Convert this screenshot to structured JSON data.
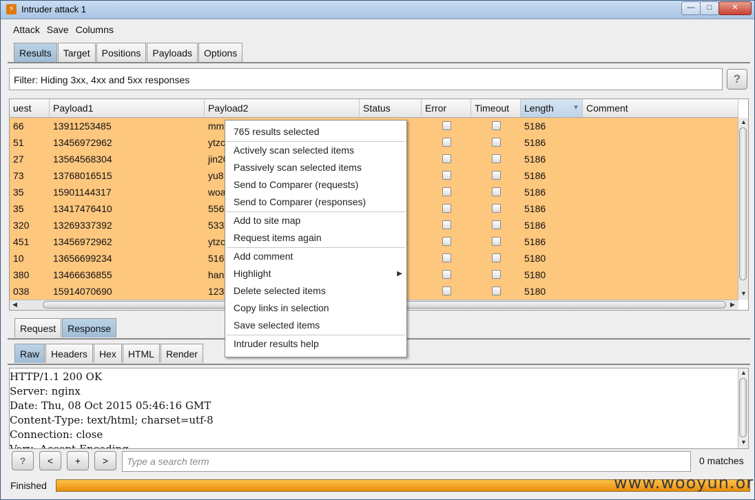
{
  "window": {
    "title": "Intruder attack 1"
  },
  "menu": [
    "Attack",
    "Save",
    "Columns"
  ],
  "tabs": [
    "Results",
    "Target",
    "Positions",
    "Payloads",
    "Options"
  ],
  "filter": {
    "text": "Filter: Hiding 3xx, 4xx and 5xx responses",
    "help": "?"
  },
  "table": {
    "columns": [
      "uest",
      "Payload1",
      "Payload2",
      "Status",
      "Error",
      "Timeout",
      "Length",
      "Comment"
    ],
    "sorted_column": "Length",
    "row_color": "#fec77e",
    "rows": [
      {
        "request": "66",
        "payload1": "13911253485",
        "payload2": "mm",
        "length": "5186"
      },
      {
        "request": "51",
        "payload1": "13456972962",
        "payload2": "ytzc",
        "length": "5186"
      },
      {
        "request": "27",
        "payload1": "13564568304",
        "payload2": "jin20",
        "length": "5186"
      },
      {
        "request": "73",
        "payload1": "13768016515",
        "payload2": "yu8",
        "length": "5186"
      },
      {
        "request": "35",
        "payload1": "15901144317",
        "payload2": "woa",
        "length": "5186"
      },
      {
        "request": "35",
        "payload1": "13417476410",
        "payload2": "556",
        "length": "5186"
      },
      {
        "request": "320",
        "payload1": "13269337392",
        "payload2": "533",
        "length": "5186"
      },
      {
        "request": "451",
        "payload1": "13456972962",
        "payload2": "ytzc",
        "length": "5186"
      },
      {
        "request": "10",
        "payload1": "13656699234",
        "payload2": "516",
        "length": "5180"
      },
      {
        "request": "380",
        "payload1": "13466636855",
        "payload2": "han",
        "length": "5180"
      },
      {
        "request": "038",
        "payload1": "15914070690",
        "payload2": "123",
        "length": "5180"
      }
    ]
  },
  "context_menu": {
    "header": "765 results selected",
    "groups": [
      [
        "Actively scan selected items",
        "Passively scan selected items",
        "Send to Comparer (requests)",
        "Send to Comparer (responses)"
      ],
      [
        "Add to site map",
        "Request items again"
      ],
      [
        "Add comment",
        "Highlight",
        "Delete selected items",
        "Copy links in selection",
        "Save selected items"
      ],
      [
        "Intruder results help"
      ]
    ]
  },
  "detail_tabs": [
    "Request",
    "Response"
  ],
  "view_tabs": [
    "Raw",
    "Headers",
    "Hex",
    "HTML",
    "Render"
  ],
  "response_text": "HTTP/1.1 200 OK\nServer: nginx\nDate: Thu, 08 Oct 2015 05:46:16 GMT\nContent-Type: text/html; charset=utf-8\nConnection: close\nVary: Accept-Encoding",
  "search": {
    "placeholder": "Type a search term",
    "buttons": [
      "?",
      "<",
      "+",
      ">"
    ],
    "matches": "0 matches"
  },
  "status": {
    "label": "Finished",
    "progress": 1.0
  },
  "watermark": "www.wooyun.org"
}
